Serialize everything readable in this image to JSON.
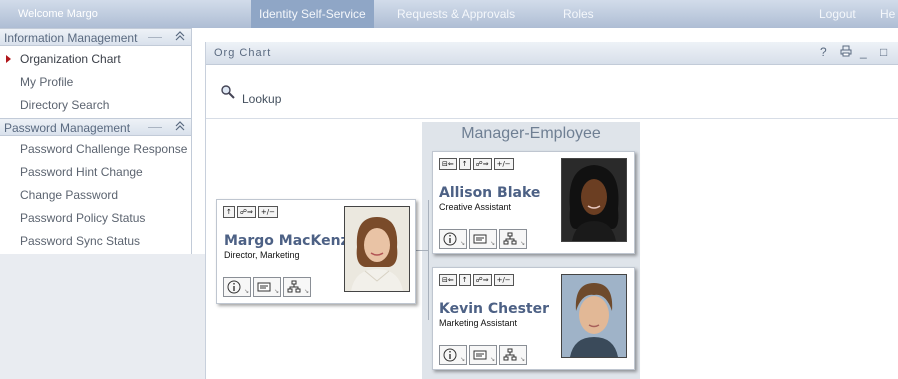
{
  "topbar": {
    "welcome": "Welcome Margo",
    "tabs": [
      "Identity Self-Service",
      "Requests & Approvals",
      "Roles"
    ],
    "active_tab": "Identity Self-Service",
    "logout": "Logout",
    "help": "He"
  },
  "sidebar": {
    "sections": [
      {
        "title": "Information Management",
        "items": [
          "Organization Chart",
          "My Profile",
          "Directory Search"
        ]
      },
      {
        "title": "Password Management",
        "items": [
          "Password Challenge Response",
          "Password Hint Change",
          "Change Password",
          "Password Policy Status",
          "Password Sync Status"
        ]
      }
    ],
    "collapse_glyph": "≈",
    "active_item": "Organization Chart"
  },
  "portlet": {
    "title": "Org Chart",
    "controls": [
      "?",
      "🖶",
      "_",
      "□"
    ],
    "lookup_label": "Lookup"
  },
  "org": {
    "group_title": "Manager-Employee",
    "manager": {
      "name": "Margo MacKenzie",
      "title": "Director, Marketing",
      "buttons": [
        "↑",
        "☍⇒",
        "+/−"
      ]
    },
    "employees": [
      {
        "name": "Allison Blake",
        "title": "Creative Assistant",
        "buttons": [
          "⊟⇐",
          "↑",
          "☍⇒",
          "+/−"
        ]
      },
      {
        "name": "Kevin Chester",
        "title": "Marketing Assistant",
        "buttons": [
          "⊟⇐",
          "↑",
          "☍⇒",
          "+/−"
        ]
      }
    ]
  },
  "colors": {
    "topbar": "#aebdd4",
    "active_tab": "#8fa6c6",
    "name_text": "#4d6185",
    "group_panel": "#dfe4ea",
    "active_marker": "#b0161b"
  }
}
